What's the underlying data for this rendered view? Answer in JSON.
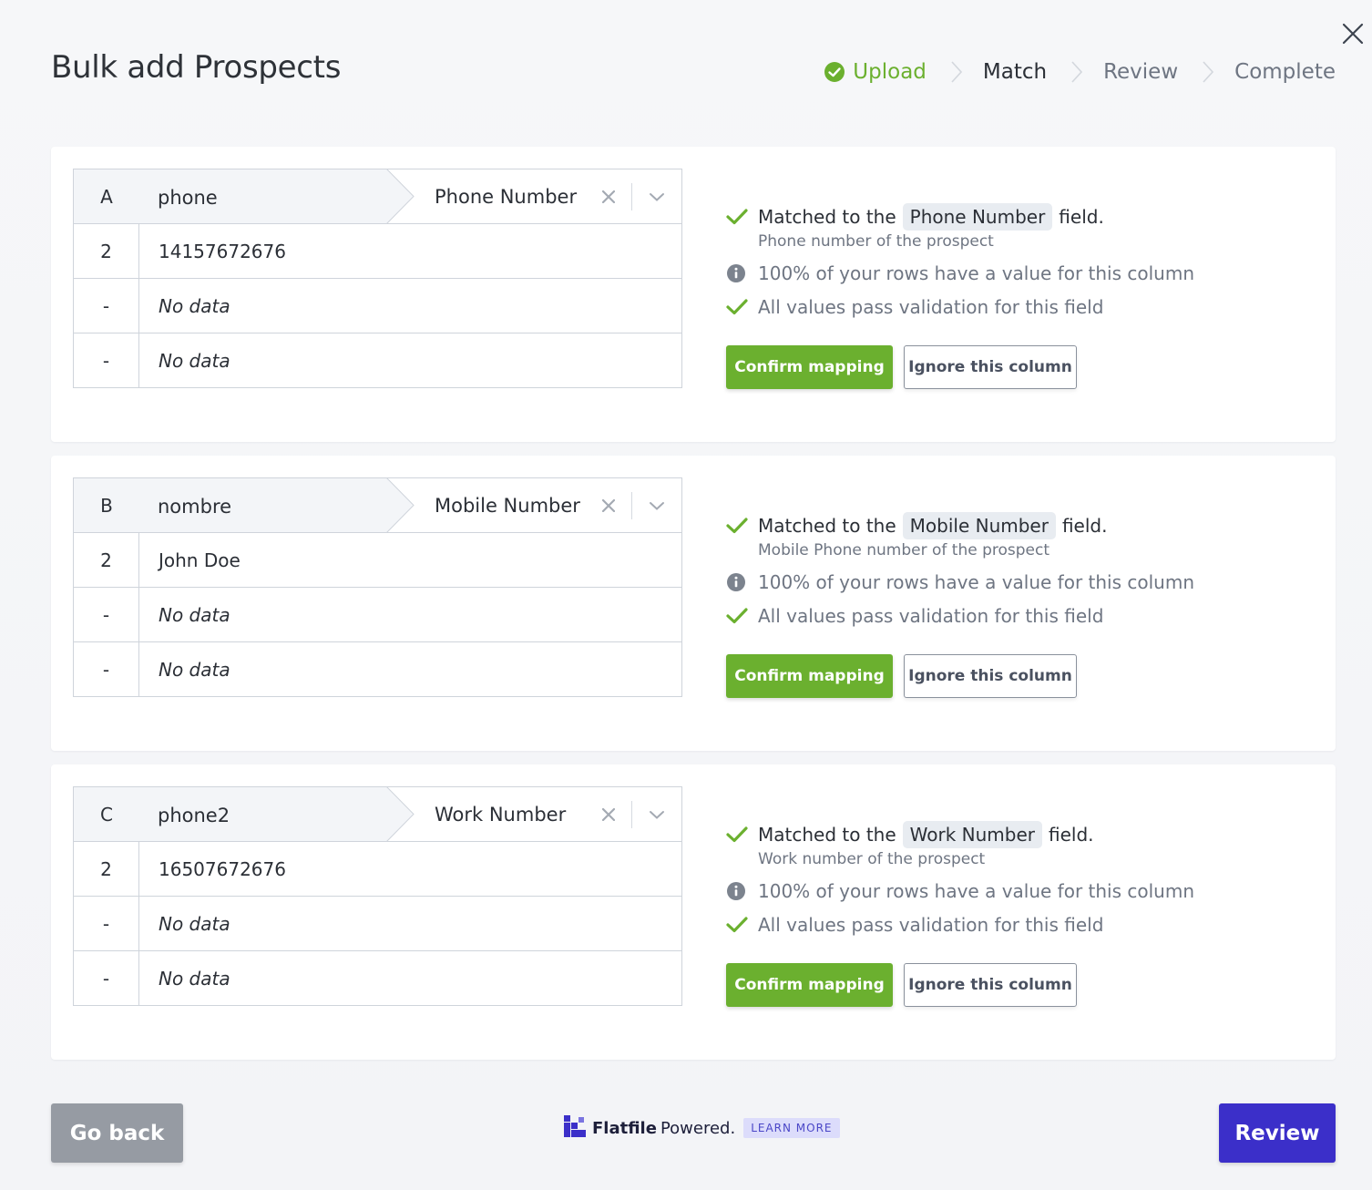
{
  "title": "Bulk add Prospects",
  "stepper": [
    {
      "label": "Upload",
      "state": "done"
    },
    {
      "label": "Match",
      "state": "active"
    },
    {
      "label": "Review",
      "state": "pending"
    },
    {
      "label": "Complete",
      "state": "pending"
    }
  ],
  "columns": [
    {
      "letter": "A",
      "name": "phone",
      "field": "Phone Number",
      "rows": [
        {
          "index": "2",
          "value": "14157672676"
        },
        {
          "index": "-",
          "value": "No data"
        },
        {
          "index": "-",
          "value": "No data"
        }
      ],
      "match_prefix": "Matched to the",
      "match_field": "Phone Number",
      "match_suffix": "field.",
      "description": "Phone number of the prospect",
      "coverage": "100% of your rows have a value for this column",
      "validation": "All values pass validation for this field",
      "confirm_label": "Confirm mapping",
      "ignore_label": "Ignore this column"
    },
    {
      "letter": "B",
      "name": "nombre",
      "field": "Mobile Number",
      "rows": [
        {
          "index": "2",
          "value": "John Doe"
        },
        {
          "index": "-",
          "value": "No data"
        },
        {
          "index": "-",
          "value": "No data"
        }
      ],
      "match_prefix": "Matched to the",
      "match_field": "Mobile Number",
      "match_suffix": "field.",
      "description": "Mobile Phone number of the prospect",
      "coverage": "100% of your rows have a value for this column",
      "validation": "All values pass validation for this field",
      "confirm_label": "Confirm mapping",
      "ignore_label": "Ignore this column"
    },
    {
      "letter": "C",
      "name": "phone2",
      "field": "Work Number",
      "rows": [
        {
          "index": "2",
          "value": "16507672676"
        },
        {
          "index": "-",
          "value": "No data"
        },
        {
          "index": "-",
          "value": "No data"
        }
      ],
      "match_prefix": "Matched to the",
      "match_field": "Work Number",
      "match_suffix": "field.",
      "description": "Work number of the prospect",
      "coverage": "100% of your rows have a value for this column",
      "validation": "All values pass validation for this field",
      "confirm_label": "Confirm mapping",
      "ignore_label": "Ignore this column"
    }
  ],
  "footer": {
    "back_label": "Go back",
    "review_label": "Review",
    "brand": "Flatfile",
    "powered": "Powered.",
    "learn_more": "LEARN MORE"
  },
  "icons": {
    "close": "close-icon",
    "step_done": "check-circle-icon",
    "step_separator": "chevron-right-icon",
    "clear": "x-icon",
    "dropdown": "chevron-down-icon",
    "matched": "checkmark-icon",
    "info": "info-circle-icon",
    "brand_logo": "flatfile-logo-icon"
  },
  "colors": {
    "success": "#6bb02f",
    "primary": "#3b2fc9",
    "muted_button": "#969ba3",
    "chip": "#e8ecf1",
    "learn_more_bg": "#dcdcfb"
  }
}
